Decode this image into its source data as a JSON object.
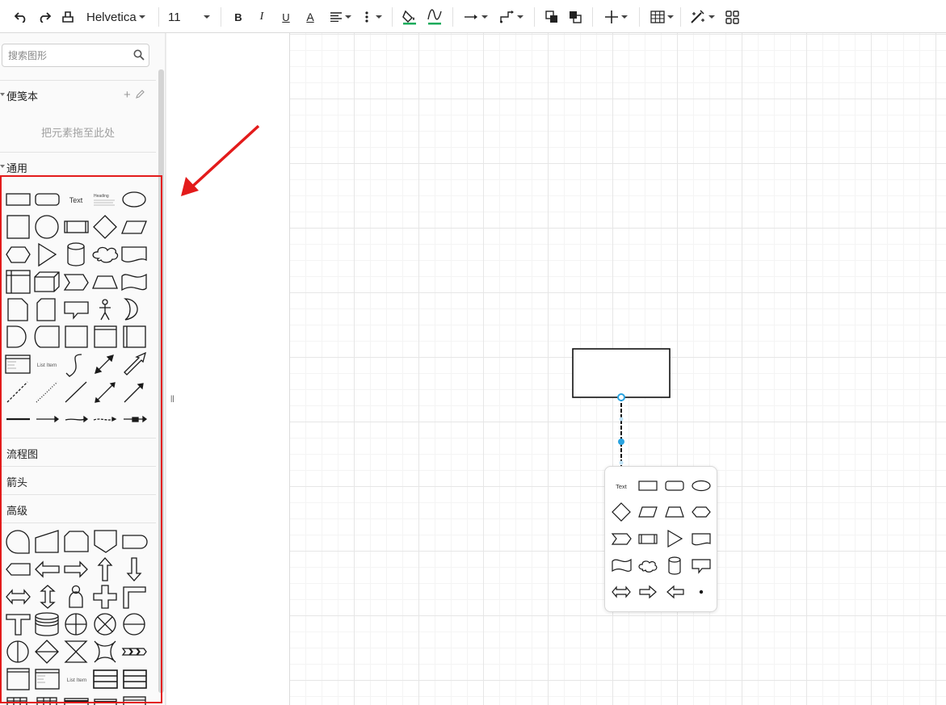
{
  "toolbar": {
    "font_family": "Helvetica",
    "font_size": "11",
    "bold_label": "B",
    "italic_label": "I",
    "underline_label": "U",
    "font_color_label": "A",
    "icons": [
      "undo-icon",
      "redo-icon",
      "format-painter-icon",
      "align-icon",
      "more-vertical-icon",
      "fill-color-icon",
      "line-color-icon",
      "connector-style-icon",
      "waypoint-icon",
      "to-front-icon",
      "to-back-icon",
      "insert-icon",
      "table-icon",
      "edit-style-icon",
      "grid-view-icon"
    ],
    "fill_color": "#1aab5c",
    "line_color": "#1aab5c"
  },
  "sidebar": {
    "search_placeholder": "搜索图形",
    "scratchpad": {
      "title": "便笺本",
      "drop_hint": "把元素拖至此处"
    },
    "general": {
      "title": "通用",
      "text_label": "Text",
      "heading_label": "Heading",
      "list_item_label": "List Item"
    },
    "collapsed_sections": [
      "流程图",
      "箭头"
    ],
    "advanced": {
      "title": "高级",
      "list_item_label": "List Item"
    }
  },
  "popup": {
    "text_label": "Text"
  },
  "colors": {
    "highlight": "#e31b1b",
    "selection": "#29a3e0"
  }
}
